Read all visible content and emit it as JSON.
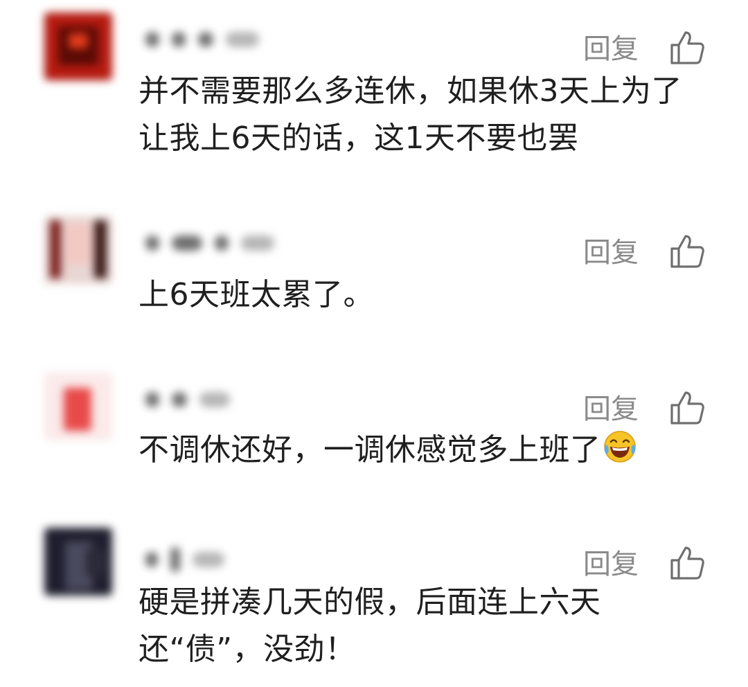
{
  "colors": {
    "text": "#1f1f1f",
    "reply": "#8a8a8a",
    "icon": "#6f6f6f"
  },
  "comments": [
    {
      "reply_label": "回复",
      "text": "并不需要那么多连休，如果休3天上为了让我上6天的话，这1天不要也罢"
    },
    {
      "reply_label": "回复",
      "text": "上6天班太累了。"
    },
    {
      "reply_label": "回复",
      "text": "不调休还好，一调休感觉多上班了",
      "emoji": "laughing-tears-emoji"
    },
    {
      "reply_label": "回复",
      "text": "硬是拼凑几天的假，后面连上六天还“债”，没劲！"
    }
  ]
}
